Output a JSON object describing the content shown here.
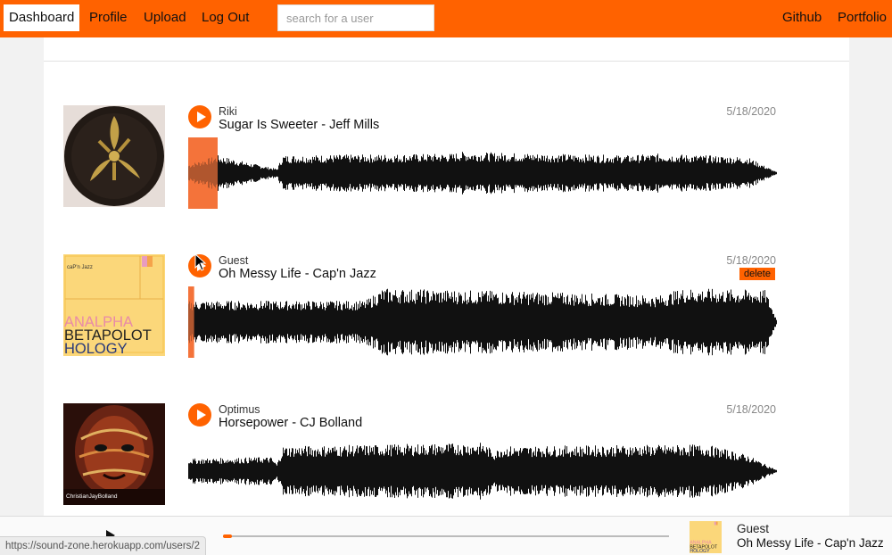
{
  "nav": {
    "dashboard": "Dashboard",
    "profile": "Profile",
    "upload": "Upload",
    "logout": "Log Out",
    "search_placeholder": "search for a user",
    "github": "Github",
    "portfolio": "Portfolio"
  },
  "tracks": [
    {
      "uploader": "Riki",
      "title": "Sugar Is Sweeter - Jeff Mills",
      "date": "5/18/2020",
      "progress": 0.05
    },
    {
      "uploader": "Guest",
      "title": "Oh Messy Life - Cap'n Jazz",
      "date": "5/18/2020",
      "delete_label": "delete",
      "progress": 0.01
    },
    {
      "uploader": "Optimus",
      "title": "Horsepower - CJ Bolland",
      "date": "5/18/2020",
      "progress": 0
    }
  ],
  "art": {
    "capn_jazz_small": "caP'n Jazz",
    "capn_jazz_lines": [
      "ANALPHA",
      "BETAPOLOT",
      "HOLOGY"
    ],
    "bolland_name": "ChristianJayBolland"
  },
  "player": {
    "uploader": "Guest",
    "title": "Oh Messy Life - Cap'n Jazz",
    "progress": 0.02
  },
  "status_url": "https://sound-zone.herokuapp.com/users/2",
  "colors": {
    "accent": "#ff6200",
    "played": "#f3743a"
  }
}
